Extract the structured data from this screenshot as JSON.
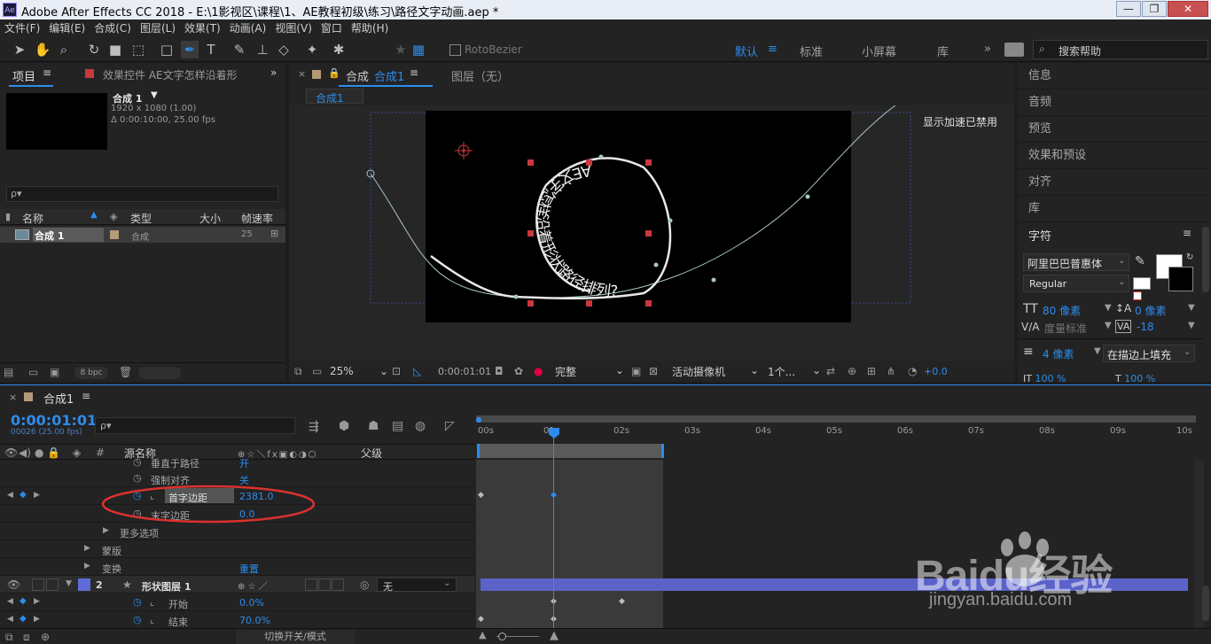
{
  "titlebar": {
    "app_icon": "Ae",
    "title": "Adobe After Effects CC 2018 - E:\\1影视区\\课程\\1、AE教程初级\\练习\\路径文字动画.aep *",
    "min": "—",
    "max": "❐",
    "close": "✕"
  },
  "menu": [
    "文件(F)",
    "编辑(E)",
    "合成(C)",
    "图层(L)",
    "效果(T)",
    "动画(A)",
    "视图(V)",
    "窗口",
    "帮助(H)"
  ],
  "toolbar": {
    "rotobezier": "RotoBezier",
    "workspaces": [
      "默认",
      "标准",
      "小屏幕",
      "库"
    ],
    "active_workspace": "默认",
    "search_placeholder": "搜索帮助",
    "more": "»"
  },
  "project": {
    "tab": "项目",
    "effects_tab": "效果控件 AE文字怎样沿着形",
    "comp_name": "合成 1",
    "resolution": "1920 x 1080 (1.00)",
    "duration": "Δ 0:00:10:00, 25.00 fps",
    "search_placeholder": "ρ▾",
    "columns": {
      "name": "名称",
      "type": "类型",
      "size": "大小",
      "fps": "帧速率"
    },
    "items": [
      {
        "name": "合成 1",
        "type": "合成",
        "fps": "25"
      }
    ],
    "bpc": "8 bpc"
  },
  "viewer": {
    "tab": "合成",
    "tab_comp": "合成1",
    "layer_tab": "图层（无）",
    "crumb": "合成1",
    "gpu_note": "显示加速已禁用",
    "path_text": "AE文字怎样沿着形状路径排列?",
    "zoom": "25%",
    "timecode": "0:00:01:01",
    "quality": "完整",
    "camera": "活动摄像机",
    "views": "1个...",
    "exposure": "+0.0"
  },
  "right_panel": {
    "items": [
      "信息",
      "音频",
      "预览",
      "效果和预设",
      "对齐",
      "库"
    ],
    "char_title": "字符",
    "font": "阿里巴巴普惠体",
    "style": "Regular",
    "size": "80 像素",
    "leading": "0 像素",
    "kerning": "度量标准",
    "tracking": "-18",
    "stroke": "4 像素",
    "stroke_mode": "在描边上填充",
    "scale_v": "100 %",
    "scale_h": "100 %"
  },
  "timeline": {
    "tab": "合成1",
    "timecode": "0:00:01:01",
    "frames": "00026 (25.00 fps)",
    "search_placeholder": "ρ▾",
    "col_source": "源名称",
    "col_parent": "父级",
    "ruler": [
      "00s",
      "01s",
      "02s",
      "03s",
      "04s",
      "05s",
      "06s",
      "07s",
      "08s",
      "09s",
      "10s"
    ],
    "rows": [
      {
        "name": "垂直于路径",
        "value": "开"
      },
      {
        "name": "强制对齐",
        "value": "关"
      },
      {
        "name": "首字边距",
        "value": "2381.0"
      },
      {
        "name": "末字边距",
        "value": "0.0"
      },
      {
        "name": "更多选项",
        "value": ""
      },
      {
        "name": "蒙版",
        "value": ""
      },
      {
        "name": "变换",
        "value": "重置"
      },
      {
        "name": "形状图层 1",
        "num": "2",
        "parent": "无"
      },
      {
        "name": "开始",
        "value": "0.0%"
      },
      {
        "name": "结束",
        "value": "70.0%"
      }
    ],
    "footer": "切换开关/模式"
  },
  "watermark": {
    "brand": "Baidu经验",
    "url": "jingyan.baidu.com"
  }
}
